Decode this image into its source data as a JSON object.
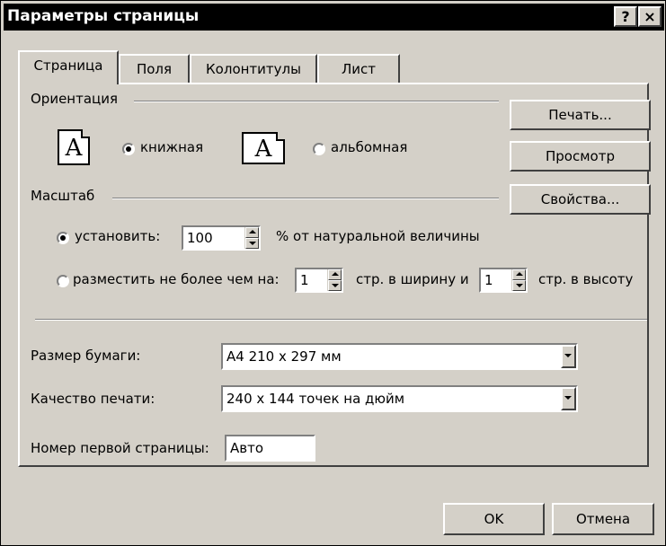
{
  "dialog": {
    "title": "Параметры страницы",
    "help_button": "?",
    "close_button": "×"
  },
  "tabs": [
    {
      "label": "Страница",
      "active": true
    },
    {
      "label": "Поля",
      "active": false
    },
    {
      "label": "Колонтитулы",
      "active": false
    },
    {
      "label": "Лист",
      "active": false
    }
  ],
  "orientation": {
    "group_label": "Ориентация",
    "portrait": {
      "label": "книжная",
      "selected": true,
      "icon": "portrait-page-icon"
    },
    "landscape": {
      "label": "альбомная",
      "selected": false,
      "icon": "landscape-page-icon"
    },
    "icon_letter": "A"
  },
  "scale": {
    "group_label": "Масштаб",
    "adjust": {
      "label": "установить:",
      "selected": true,
      "value": "100",
      "suffix": "% от натуральной величины"
    },
    "fit": {
      "label": "разместить не более чем на:",
      "selected": false,
      "wide_value": "1",
      "wide_label": "стр. в ширину и",
      "tall_value": "1",
      "tall_label": "стр. в высоту"
    }
  },
  "paper_size": {
    "label": "Размер бумаги:",
    "value": "A4 210 x 297 мм"
  },
  "print_quality": {
    "label": "Качество печати:",
    "value": "240 x 144 точек на дюйм"
  },
  "first_page_number": {
    "label": "Номер первой страницы:",
    "value": "Авто"
  },
  "side_buttons": {
    "print": "Печать...",
    "preview": "Просмотр",
    "properties": "Свойства..."
  },
  "footer_buttons": {
    "ok": "OK",
    "cancel": "Отмена"
  },
  "colors": {
    "face": "#d4d0c8",
    "titlebar": "#000000",
    "title_text": "#ffffff"
  }
}
